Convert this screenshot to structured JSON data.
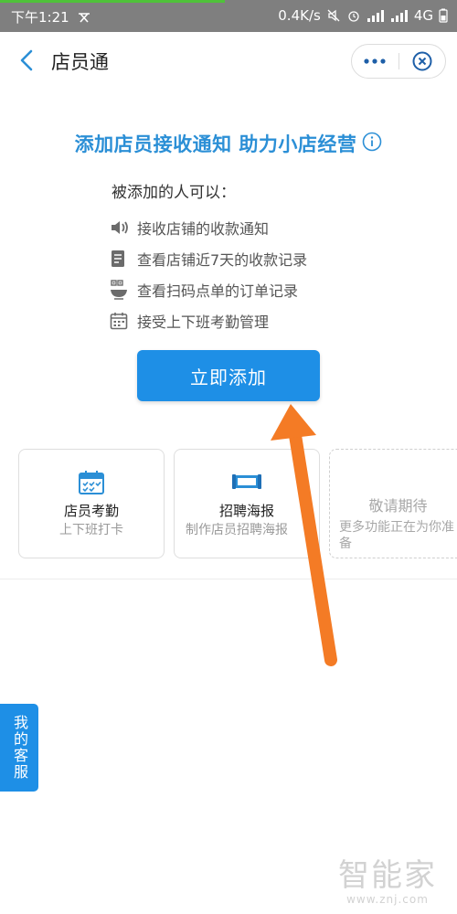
{
  "status_bar": {
    "time": "下午1:21",
    "speed": "0.4K/s",
    "network": "4G"
  },
  "nav": {
    "title": "店员通"
  },
  "headline": "添加店员接收通知 助力小店经营",
  "subtitle": "被添加的人可以：",
  "permissions": [
    {
      "text": "接收店铺的收款通知",
      "icon": "speaker-icon"
    },
    {
      "text": "查看店铺近7天的收款记录",
      "icon": "document-icon"
    },
    {
      "text": "查看扫码点单的订单记录",
      "icon": "qrcode-bowl-icon"
    },
    {
      "text": "接受上下班考勤管理",
      "icon": "calendar-icon"
    }
  ],
  "add_button": "立即添加",
  "cards": [
    {
      "title": "店员考勤",
      "desc": "上下班打卡",
      "icon": "calendar-check-icon"
    },
    {
      "title": "招聘海报",
      "desc": "制作店员招聘海报",
      "icon": "poster-icon"
    },
    {
      "title": "敬请期待",
      "desc": "更多功能正在为你准备"
    }
  ],
  "service_tab": "我的客服",
  "watermark": {
    "main": "智能家",
    "sub": "www.znj.com"
  },
  "colors": {
    "accent": "#1e8fe6",
    "headline": "#2b8fd6",
    "arrow": "#f47b25"
  }
}
